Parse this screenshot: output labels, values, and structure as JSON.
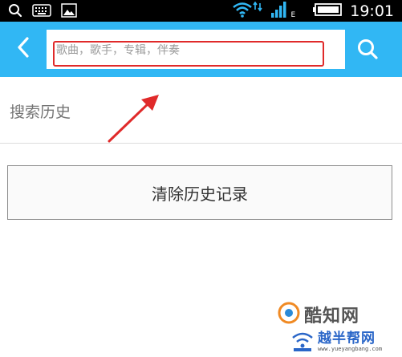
{
  "status_bar": {
    "time": "19:01",
    "network_label": "E",
    "icons": [
      "search-icon",
      "keyboard-icon",
      "image-icon",
      "wifi-icon",
      "data-transfer-icon",
      "signal-icon",
      "battery-icon"
    ]
  },
  "header": {
    "back_icon": "chevron-left-icon",
    "search_placeholder": "歌曲，歌手，专辑，伴奏",
    "search_value": "",
    "search_icon": "search-icon",
    "color": "#31b7f4"
  },
  "history": {
    "title": "搜索历史",
    "clear_label": "清除历史记录"
  },
  "annotation": {
    "highlight_color": "#e02a2a"
  },
  "watermarks": {
    "primary": "酷知网",
    "secondary": "越半帮网",
    "secondary_url": "www.yueyangbang.com"
  }
}
